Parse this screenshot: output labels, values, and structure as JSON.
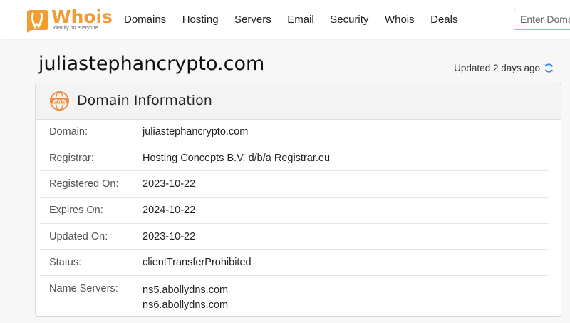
{
  "header": {
    "logo_text": "Whois",
    "logo_tagline": "Identity for everyone",
    "nav": [
      "Domains",
      "Hosting",
      "Servers",
      "Email",
      "Security",
      "Whois",
      "Deals"
    ],
    "search_placeholder": "Enter Domain or IP"
  },
  "page": {
    "domain": "juliastephancrypto.com",
    "updated": "Updated 2 days ago"
  },
  "card": {
    "title": "Domain Information",
    "rows": [
      {
        "label": "Domain:",
        "value": "juliastephancrypto.com"
      },
      {
        "label": "Registrar:",
        "value": "Hosting Concepts B.V. d/b/a Registrar.eu"
      },
      {
        "label": "Registered On:",
        "value": "2023-10-22"
      },
      {
        "label": "Expires On:",
        "value": "2024-10-22"
      },
      {
        "label": "Updated On:",
        "value": "2023-10-22"
      },
      {
        "label": "Status:",
        "value": "clientTransferProhibited"
      }
    ],
    "name_servers_label": "Name Servers:",
    "name_servers": [
      "ns5.abollydns.com",
      "ns6.abollydns.com"
    ]
  },
  "colors": {
    "accent": "#f39c31",
    "refresh": "#3a8ee6"
  },
  "icons": [
    "logo-badge-icon",
    "refresh-icon",
    "www-globe-icon"
  ]
}
